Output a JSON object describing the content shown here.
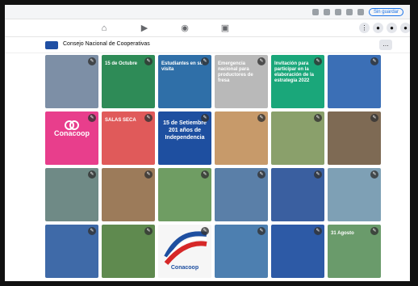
{
  "browser": {
    "profile_label": "Sin guardar",
    "icons": [
      "zoom-icon",
      "star-icon",
      "extensions-icon",
      "puzzle-icon",
      "sidebar-icon"
    ]
  },
  "navbar": {
    "tabs": [
      "home-icon",
      "watch-icon",
      "marketplace-icon",
      "gaming-icon"
    ],
    "right_icons": [
      "menu-grid-icon",
      "messenger-icon",
      "notifications-icon",
      "account-icon"
    ]
  },
  "page": {
    "title": "Consejo Nacional de Cooperativas",
    "more_label": "…"
  },
  "tiles": [
    {
      "bg": "#7d8fa6",
      "text": ""
    },
    {
      "bg": "#2e8b57",
      "text": "15 de Octubre"
    },
    {
      "bg": "#2f6fa8",
      "text": "Estudiantes en su visita"
    },
    {
      "bg": "#b9b9b9",
      "text": "Emergencia nacional para productores de fresa"
    },
    {
      "bg": "#1aa77a",
      "text": "Invitación para participar en la elaboración de la estrategia 2022"
    },
    {
      "bg": "#3b6fb6",
      "text": ""
    },
    {
      "bg": "#e83e8c",
      "text": "Conacoop",
      "brand": true
    },
    {
      "bg": "#e05a5a",
      "text": "SALAS SECA"
    },
    {
      "bg": "#1e4fa0",
      "text": "15 de Setiembre 201 años de Independencia",
      "date": true
    },
    {
      "bg": "#c79a6a",
      "text": ""
    },
    {
      "bg": "#8aa06b",
      "text": ""
    },
    {
      "bg": "#7e6a54",
      "text": ""
    },
    {
      "bg": "#6f8a86",
      "text": ""
    },
    {
      "bg": "#9c7b5a",
      "text": ""
    },
    {
      "bg": "#6f9d63",
      "text": ""
    },
    {
      "bg": "#5a7fa8",
      "text": ""
    },
    {
      "bg": "#3a5fa0",
      "text": ""
    },
    {
      "bg": "#7ea0b5",
      "text": ""
    },
    {
      "bg": "#3f6aa8",
      "text": ""
    },
    {
      "bg": "#5f8a4f",
      "text": ""
    },
    {
      "bg": "#f6f6f6",
      "text": "Conacoop",
      "flag": true
    },
    {
      "bg": "#4d7fb0",
      "text": ""
    },
    {
      "bg": "#2d5aa6",
      "text": ""
    },
    {
      "bg": "#6a9b6b",
      "text": "31 Agosto"
    }
  ]
}
